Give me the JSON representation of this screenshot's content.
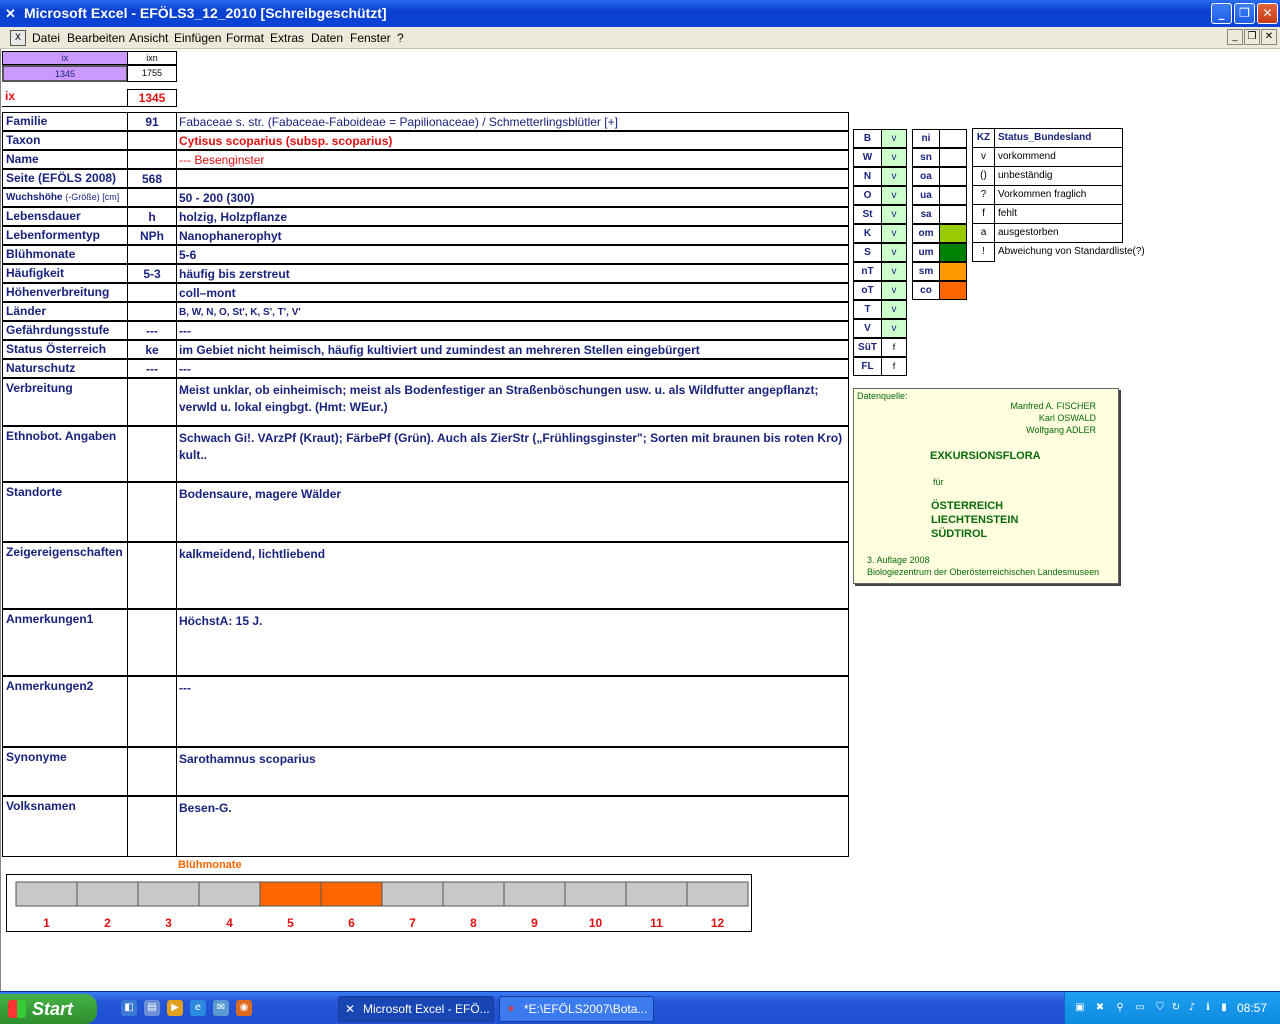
{
  "window": {
    "app_icon": "excel-icon",
    "title": "Microsoft Excel - EFÖLS3_12_2010  [Schreibgeschützt]",
    "controls": [
      "_",
      "❐",
      "✕"
    ]
  },
  "menu": {
    "items": [
      "Datei",
      "Bearbeiten",
      "Ansicht",
      "Einfügen",
      "Format",
      "Extras",
      "Daten",
      "Fenster",
      "?"
    ],
    "doc_controls": [
      "_",
      "❐",
      "✕"
    ]
  },
  "index_box": {
    "col1_header": "ix",
    "col2_header": "ixn",
    "col1_value": "1345",
    "col2_value": "1755",
    "ix_label": "ix",
    "ix_value": "1345"
  },
  "record": {
    "rows": [
      {
        "label": "Familie",
        "code": "91",
        "value": "Fabaceae s. str. (Fabaceae-Faboideae = Papilionaceae)  /  Schmetterlingsblütler [+]"
      },
      {
        "label": "Taxon",
        "code": "",
        "value": "Cytisus scoparius (subsp. scoparius)"
      },
      {
        "label": "Name",
        "code": "",
        "value": "--- Besenginster"
      },
      {
        "label": "Seite (EFÖLS 2008)",
        "code": "568",
        "value": ""
      },
      {
        "label": "Wuchshöhe",
        "label_suffix": "(-Größe) [cm]",
        "code": "",
        "value": " 50 - 200 (300)"
      },
      {
        "label": "Lebensdauer",
        "code": "h",
        "value": "holzig, Holzpflanze"
      },
      {
        "label": "Lebenformentyp",
        "code": "NPh",
        "value": "Nanophanerophyt"
      },
      {
        "label": "Blühmonate",
        "code": "",
        "value": " 5-6"
      },
      {
        "label": "Häufigkeit",
        "code": "5-3",
        "value": "häufig bis zerstreut"
      },
      {
        "label": "Höhenverbreitung",
        "code": "",
        "value": "coll–mont"
      },
      {
        "label": "Länder",
        "code": "",
        "value": "B, W, N, O, St', K, S', T', V'"
      },
      {
        "label": "Gefährdungsstufe",
        "code": "---",
        "value": "  ---"
      },
      {
        "label": "Status Österreich",
        "code": "ke",
        "value": "im Gebiet nicht heimisch, häufig kultiviert und zumindest an mehreren Stellen eingebürgert"
      },
      {
        "label": "Naturschutz",
        "code": "---",
        "value": " ---"
      }
    ],
    "text_rows": [
      {
        "label": "Verbreitung",
        "lines": [
          "Meist unklar, ob einheimisch; meist als Bodenfestiger an Straßenböschungen usw. u. als Wildfutter angepflanzt;",
          "verwld u. lokal eingbgt. (Hmt: WEur.)"
        ]
      },
      {
        "label": "Ethnobot. Angaben",
        "lines": [
          "Schwach Gi!. VArzPf (Kraut); FärbePf (Grün). Auch als ZierStr („Frühlingsginster\"; Sorten mit braunen bis roten Kro)",
          "kult.."
        ]
      },
      {
        "label": "Standorte",
        "lines": [
          "Bodensaure, magere Wälder"
        ]
      },
      {
        "label": "Zeigereigenschaften",
        "lines": [
          " kalkmeidend, lichtliebend"
        ]
      },
      {
        "label": "Anmerkungen1",
        "lines": [
          "HöchstA: 15 J."
        ]
      },
      {
        "label": "Anmerkungen2",
        "lines": [
          "---"
        ]
      },
      {
        "label": "Synonyme",
        "lines": [
          "Sarothamnus scoparius"
        ]
      },
      {
        "label": "Volksnamen",
        "lines": [
          "Besen-G."
        ]
      }
    ]
  },
  "states": {
    "codes": [
      "B",
      "W",
      "N",
      "O",
      "St",
      "K",
      "S",
      "nT",
      "oT",
      "T",
      "V",
      "SüT",
      "FL"
    ],
    "values": [
      "v",
      "v",
      "v",
      "v",
      "v",
      "v",
      "v",
      "v",
      "v",
      "v",
      "v",
      "f",
      "f"
    ]
  },
  "altitude": {
    "codes": [
      "ni",
      "sn",
      "oa",
      "ua",
      "sa",
      "om",
      "um",
      "sm",
      "co"
    ],
    "colors": [
      "",
      "",
      "",
      "",
      "",
      "#99cc00",
      "#008000",
      "#ff9900",
      "#ff6600"
    ]
  },
  "legend": {
    "header_code": "KZ",
    "header_label": "Status_Bundesland",
    "items": [
      {
        "code": "v",
        "text": "vorkommend"
      },
      {
        "code": "()",
        "text": "unbeständig"
      },
      {
        "code": "?",
        "text": "Vorkommen fraglich"
      },
      {
        "code": "f",
        "text": "fehlt"
      },
      {
        "code": "a",
        "text": "ausgestorben"
      },
      {
        "code": "!",
        "text": "Abweichung von Standardliste(?)"
      }
    ]
  },
  "source": {
    "label": "Datenquelle:",
    "authors": [
      "Manfred A. FISCHER",
      "Karl OSWALD",
      "Wolfgang ADLER"
    ],
    "title": "EXKURSIONSFLORA",
    "fuer": "für",
    "regions": [
      "ÖSTERREICH",
      "LIECHTENSTEIN",
      "SÜDTIROL"
    ],
    "edition": "3. Auflage 2008",
    "publisher": "Biologiezentrum der Oberösterreichischen Landesmuseen"
  },
  "chart_data": {
    "type": "bar",
    "title": "Blühmonate",
    "categories": [
      "1",
      "2",
      "3",
      "4",
      "5",
      "6",
      "7",
      "8",
      "9",
      "10",
      "11",
      "12"
    ],
    "highlighted": [
      5,
      6
    ],
    "colors": {
      "default": "#c8c8c8",
      "flowering": "#ff6600"
    }
  },
  "taskbar": {
    "start_label": "Start",
    "quicklaunch": [
      "quicklaunch-icon",
      "explorer-icon",
      "media-icon",
      "ie-icon",
      "mail-icon",
      "firefox-icon"
    ],
    "apps": [
      {
        "label": "Microsoft Excel - EFÖ...",
        "icon": "excel-icon"
      },
      {
        "label": "*E:\\EFÖLS2007\\Bota...",
        "icon": "doc-icon"
      }
    ],
    "clock": "08:57"
  }
}
